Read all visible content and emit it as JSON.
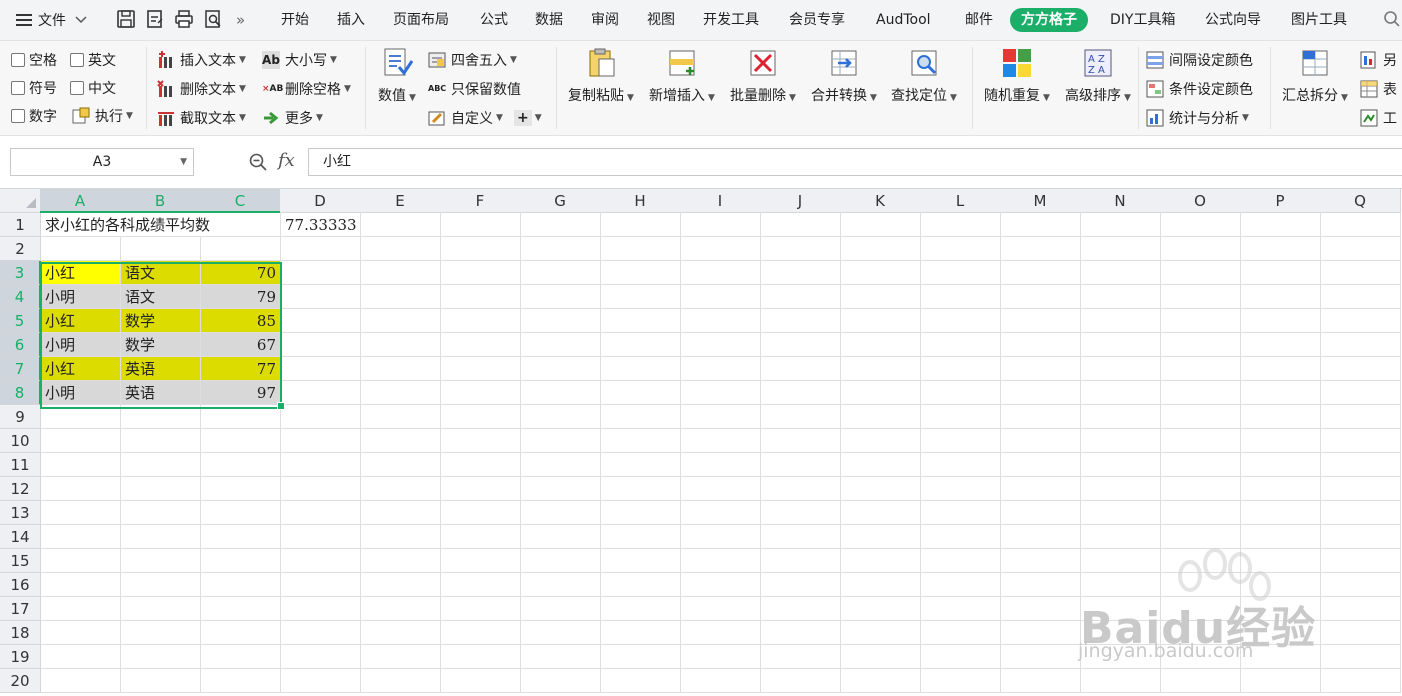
{
  "menu": {
    "file": "文件",
    "tabs": [
      "开始",
      "插入",
      "页面布局",
      "公式",
      "数据",
      "审阅",
      "视图",
      "开发工具",
      "会员专享",
      "AudTool",
      "邮件",
      "方方格子",
      "DIY工具箱",
      "公式向导",
      "图片工具"
    ],
    "active_tab": "方方格子",
    "accent": "#1aae68"
  },
  "ribbon": {
    "checkboxes": [
      "空格",
      "英文",
      "符号",
      "中文",
      "数字"
    ],
    "execute": "执行",
    "insert_text": "插入文本",
    "delete_text": "删除文本",
    "extract_text": "截取文本",
    "case": "大小写",
    "delete_space": "删除空格",
    "more": "更多",
    "numeric": "数值",
    "round": "四舍五入",
    "keep_numbers": "只保留数值",
    "custom": "自定义",
    "copy_paste": "复制粘贴",
    "add_insert": "新增插入",
    "batch_delete": "批量删除",
    "merge_convert": "合并转换",
    "find_locate": "查找定位",
    "random_repeat": "随机重复",
    "advanced_sort": "高级排序",
    "interval_color": "间隔设定颜色",
    "conditional_color": "条件设定颜色",
    "stats_analysis": "统计与分析",
    "summary_split": "汇总拆分",
    "other_partial": "另",
    "table_partial": "表",
    "work_partial": "工"
  },
  "formula_bar": {
    "name_box": "A3",
    "fx": "fx",
    "content": "小红"
  },
  "columns": [
    "A",
    "B",
    "C",
    "D",
    "E",
    "F",
    "G",
    "H",
    "I",
    "J",
    "K",
    "L",
    "M",
    "N",
    "O",
    "P",
    "Q"
  ],
  "selected_columns": [
    "A",
    "B",
    "C"
  ],
  "rows": [
    "1",
    "2",
    "3",
    "4",
    "5",
    "6",
    "7",
    "8",
    "9",
    "10",
    "11",
    "12",
    "13",
    "14",
    "15",
    "16",
    "17",
    "18",
    "19",
    "20"
  ],
  "selected_rows": [
    "3",
    "4",
    "5",
    "6",
    "7",
    "8"
  ],
  "cells": {
    "A1": "求小红的各科成绩平均数",
    "D1": "77.33333",
    "A3": "小红",
    "B3": "语文",
    "C3": "70",
    "A4": "小明",
    "B4": "语文",
    "C4": "79",
    "A5": "小红",
    "B5": "数学",
    "C5": "85",
    "A6": "小明",
    "B6": "数学",
    "C6": "67",
    "A7": "小红",
    "B7": "英语",
    "C7": "77",
    "A8": "小明",
    "B8": "英语",
    "C8": "97"
  },
  "colors": {
    "highlight_yellow": "#ffff00",
    "olive_yellow": "#dcdc00",
    "gray_fill": "#d8d8d8"
  },
  "watermark": {
    "brand": "Baidu经验",
    "url": "jingyan.baidu.com"
  }
}
